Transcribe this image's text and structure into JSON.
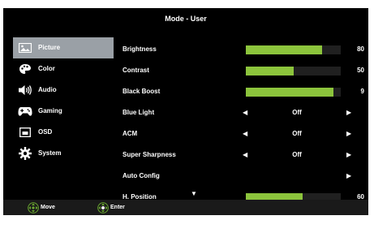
{
  "title": "Mode - User",
  "sidebar": {
    "items": [
      {
        "label": "Picture",
        "icon": "picture-icon",
        "active": true
      },
      {
        "label": "Color",
        "icon": "palette-icon"
      },
      {
        "label": "Audio",
        "icon": "speaker-icon"
      },
      {
        "label": "Gaming",
        "icon": "gamepad-icon"
      },
      {
        "label": "OSD",
        "icon": "osd-icon"
      },
      {
        "label": "System",
        "icon": "gear-icon"
      }
    ]
  },
  "rows": [
    {
      "label": "Brightness",
      "type": "bar",
      "value": 80
    },
    {
      "label": "Contrast",
      "type": "bar",
      "value": 50
    },
    {
      "label": "Black Boost",
      "type": "bar",
      "value": 9,
      "fill_fraction": 0.92
    },
    {
      "label": "Blue Light",
      "type": "select",
      "value": "Off"
    },
    {
      "label": "ACM",
      "type": "select",
      "value": "Off"
    },
    {
      "label": "Super Sharpness",
      "type": "select",
      "value": "Off"
    },
    {
      "label": "Auto Config",
      "type": "action"
    },
    {
      "label": "H. Position",
      "type": "bar",
      "value": 60
    }
  ],
  "footer": {
    "move_label": "Move",
    "enter_label": "Enter"
  },
  "colors": {
    "accent": "#8cc43c",
    "active_bg": "#9aa0a6",
    "footer_icon": "#6aa830"
  }
}
